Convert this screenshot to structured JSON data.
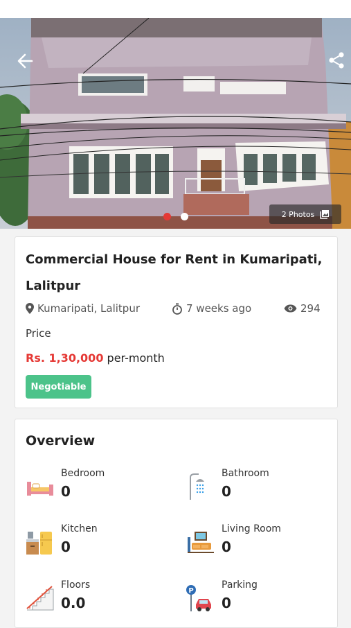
{
  "header": {
    "back_icon": "arrow-left-icon",
    "share_icon": "share-icon",
    "photo_count_label": "2 Photos",
    "gallery_icon": "gallery-icon",
    "carousel": {
      "total": 2,
      "active_index": 0,
      "active_color": "#e53935",
      "inactive_color": "#ffffff"
    }
  },
  "listing": {
    "title": "Commercial House for Rent in Kumaripati, Lalitpur",
    "location": "Kumaripati, Lalitpur",
    "posted": "7 weeks ago",
    "views": "294",
    "price_label": "Price",
    "price_amount": "Rs. 1,30,000",
    "price_unit": "per-month",
    "badge": "Negotiable",
    "badge_color": "#4cc38a",
    "price_color": "#e53935"
  },
  "overview": {
    "title": "Overview",
    "items": [
      {
        "label": "Bedroom",
        "value": "0",
        "icon": "bed-icon"
      },
      {
        "label": "Bathroom",
        "value": "0",
        "icon": "shower-icon"
      },
      {
        "label": "Kitchen",
        "value": "0",
        "icon": "kitchen-icon"
      },
      {
        "label": "Living Room",
        "value": "0",
        "icon": "living-room-icon"
      },
      {
        "label": "Floors",
        "value": "0.0",
        "icon": "stairs-icon"
      },
      {
        "label": "Parking",
        "value": "0",
        "icon": "parking-icon"
      }
    ]
  }
}
